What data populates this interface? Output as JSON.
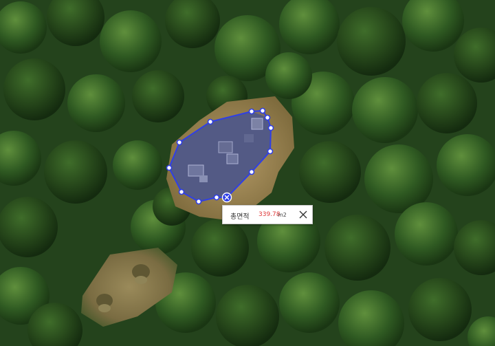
{
  "map": {
    "imagery": "satellite",
    "polygon_color": "#2f3fe6",
    "vertex_fill": "#ffffff",
    "delete_vertex_icon": "x-icon"
  },
  "measure_popup": {
    "label": "총면적",
    "value": "339.78",
    "unit": "m2",
    "value_color": "#e03a3a",
    "close_icon": "close-icon"
  }
}
